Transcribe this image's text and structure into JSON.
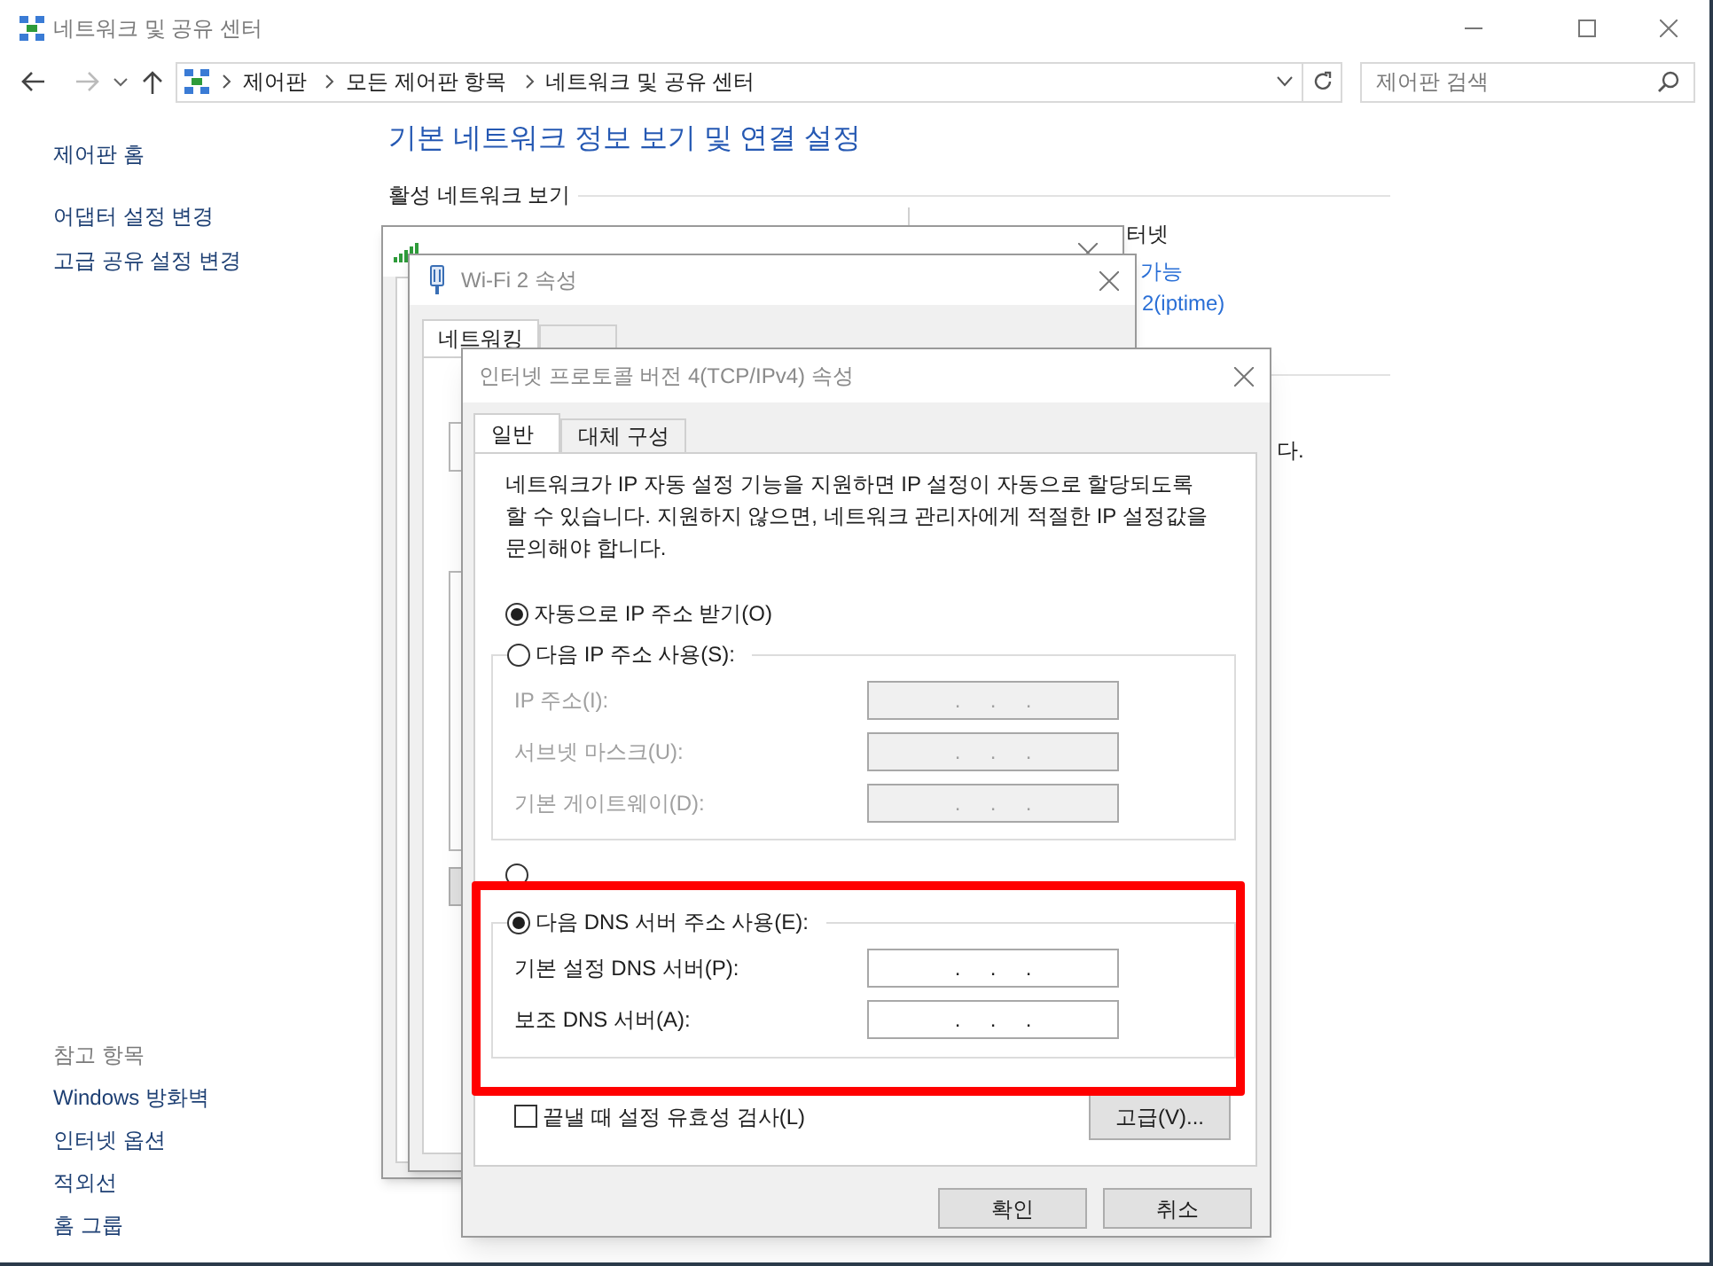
{
  "window": {
    "title": "네트워크 및 공유 센터"
  },
  "address_bar": {
    "breadcrumbs": [
      "제어판",
      "모든 제어판 항목",
      "네트워크 및 공유 센터"
    ]
  },
  "search": {
    "placeholder": "제어판 검색"
  },
  "sidebar": {
    "links": [
      "제어판 홈",
      "어댑터 설정 변경",
      "고급 공유 설정 변경"
    ],
    "see_also": {
      "title": "참고 항목",
      "links": [
        "Windows 방화벽",
        "인터넷 옵션",
        "적외선",
        "홈 그룹"
      ]
    }
  },
  "main": {
    "heading": "기본 네트워크 정보 보기 및 연결 설정",
    "section": "활성 네트워크 보기",
    "fragments": [
      {
        "text": "터넷",
        "kind": "text"
      },
      {
        "text": "가능",
        "kind": "link"
      },
      {
        "text": "2(iptime)",
        "kind": "link"
      },
      {
        "text": "다.",
        "kind": "text"
      }
    ]
  },
  "properties_window": {
    "title": "Wi-Fi 2 속성",
    "tabs": [
      {
        "label": "네트워킹",
        "selected": true
      },
      {
        "selected": false
      }
    ]
  },
  "ipv4_dialog": {
    "title": "인터넷 프로토콜 버전 4(TCP/IPv4) 속성",
    "tabs": [
      {
        "label": "일반",
        "selected": true
      },
      {
        "label": "대체 구성",
        "selected": false
      }
    ],
    "description": "네트워크가 IP 자동 설정 기능을 지원하면 IP 설정이 자동으로 할당되도록 할 수 있습니다. 지원하지 않으면, 네트워크 관리자에게 적절한 IP 설정값을 문의해야 합니다.",
    "ip_auto": {
      "label": "자동으로 IP 주소 받기(O)",
      "selected": true
    },
    "ip_manual": {
      "label": "다음 IP 주소 사용(S):",
      "selected": false,
      "fields": [
        {
          "label": "IP 주소(I):",
          "value": ".     .     .",
          "disabled": true
        },
        {
          "label": "서브넷 마스크(U):",
          "value": ".     .     .",
          "disabled": true
        },
        {
          "label": "기본 게이트웨이(D):",
          "value": ".     .     .",
          "disabled": true
        }
      ]
    },
    "dns_auto": {
      "selected": false
    },
    "dns_manual": {
      "label": "다음 DNS 서버 주소 사용(E):",
      "selected": true,
      "fields": [
        {
          "label": "기본 설정 DNS 서버(P):",
          "value": ".     .     .",
          "disabled": false
        },
        {
          "label": "보조 DNS 서버(A):",
          "value": ".     .     .",
          "disabled": false
        }
      ]
    },
    "validate": {
      "label": "끝낼 때 설정 유효성 검사(L)",
      "checked": false
    },
    "advanced_button": "고급(V)...",
    "buttons": [
      "확인",
      "취소"
    ]
  }
}
